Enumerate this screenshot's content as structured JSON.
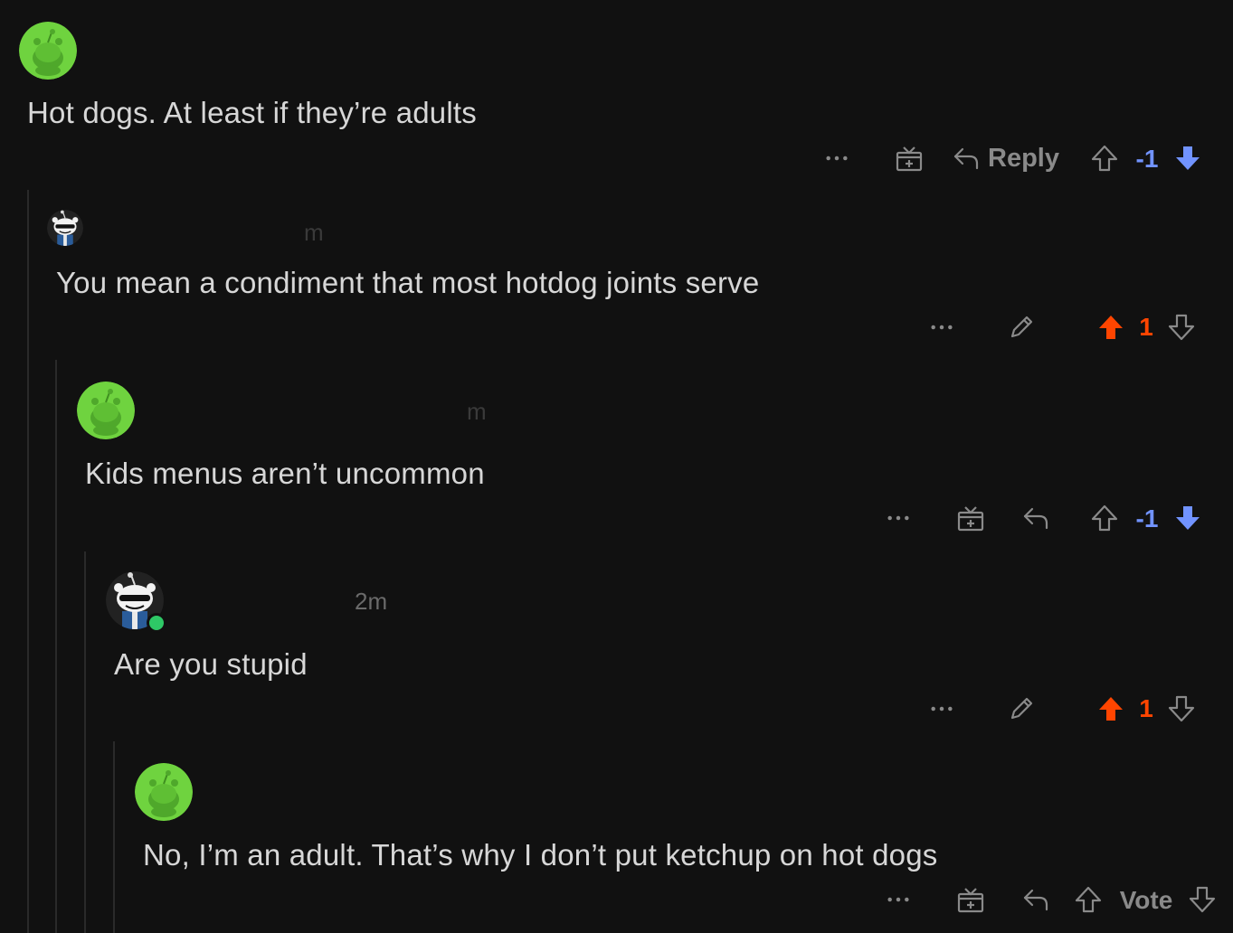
{
  "colors": {
    "background": "#111111",
    "upvote_active": "#ff4500",
    "downvote_active": "#7193ff",
    "icon_muted": "#8a8a8a",
    "online": "#2ec866"
  },
  "comments": [
    {
      "body": "Hot dogs. At least if they’re adults",
      "timestamp": "",
      "actions": {
        "more": "···",
        "reply_label": "Reply"
      },
      "score": "-1",
      "vote_state": "down"
    },
    {
      "body": "You mean a condiment that most hotdog joints serve",
      "timestamp": "m",
      "actions": {
        "more": "···"
      },
      "score": "1",
      "vote_state": "up"
    },
    {
      "body": "Kids menus aren’t uncommon",
      "timestamp": "m",
      "actions": {
        "more": "···"
      },
      "score": "-1",
      "vote_state": "down"
    },
    {
      "body": "Are you stupid",
      "timestamp": "2m",
      "actions": {
        "more": "···"
      },
      "score": "1",
      "vote_state": "up"
    },
    {
      "body": "No, I’m an adult. That’s why I don’t put ketchup on hot dogs",
      "timestamp": "",
      "actions": {
        "more": "···"
      },
      "score": "Vote",
      "vote_state": "none"
    }
  ],
  "icons": {
    "avatar_green": "snoo-avatar-green-icon",
    "avatar_custom": "snoo-avatar-sunglasses-icon",
    "more": "more-dots-icon",
    "award": "award-gift-icon",
    "reply": "reply-arrow-icon",
    "edit": "pencil-edit-icon",
    "upvote": "upvote-arrow-icon",
    "downvote": "downvote-arrow-icon"
  }
}
